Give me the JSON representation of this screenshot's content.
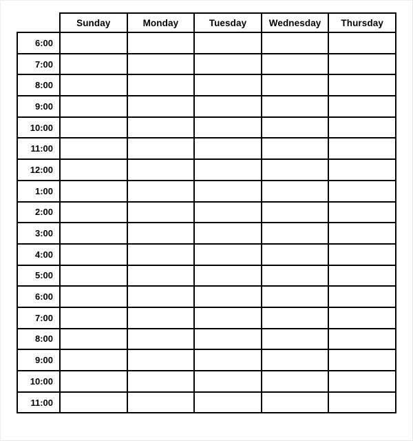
{
  "document": {
    "type": "weekly-schedule-table",
    "corner_header": "",
    "background_color": "#ffffff",
    "border_color": "#000000",
    "text_color": "#000000"
  },
  "table": {
    "day_headers": [
      "Sunday",
      "Monday",
      "Tuesday",
      "Wednesday",
      "Thursday"
    ],
    "time_labels": [
      "6:00",
      "7:00",
      "8:00",
      "9:00",
      "10:00",
      "11:00",
      "12:00",
      "1:00",
      "2:00",
      "3:00",
      "4:00",
      "5:00",
      "6:00",
      "7:00",
      "8:00",
      "9:00",
      "10:00",
      "11:00"
    ],
    "row_count": 18,
    "column_count": 5,
    "cells": [
      [
        "",
        "",
        "",
        "",
        ""
      ],
      [
        "",
        "",
        "",
        "",
        ""
      ],
      [
        "",
        "",
        "",
        "",
        ""
      ],
      [
        "",
        "",
        "",
        "",
        ""
      ],
      [
        "",
        "",
        "",
        "",
        ""
      ],
      [
        "",
        "",
        "",
        "",
        ""
      ],
      [
        "",
        "",
        "",
        "",
        ""
      ],
      [
        "",
        "",
        "",
        "",
        ""
      ],
      [
        "",
        "",
        "",
        "",
        ""
      ],
      [
        "",
        "",
        "",
        "",
        ""
      ],
      [
        "",
        "",
        "",
        "",
        ""
      ],
      [
        "",
        "",
        "",
        "",
        ""
      ],
      [
        "",
        "",
        "",
        "",
        ""
      ],
      [
        "",
        "",
        "",
        "",
        ""
      ],
      [
        "",
        "",
        "",
        "",
        ""
      ],
      [
        "",
        "",
        "",
        "",
        ""
      ],
      [
        "",
        "",
        "",
        "",
        ""
      ],
      [
        "",
        "",
        "",
        "",
        ""
      ]
    ]
  }
}
